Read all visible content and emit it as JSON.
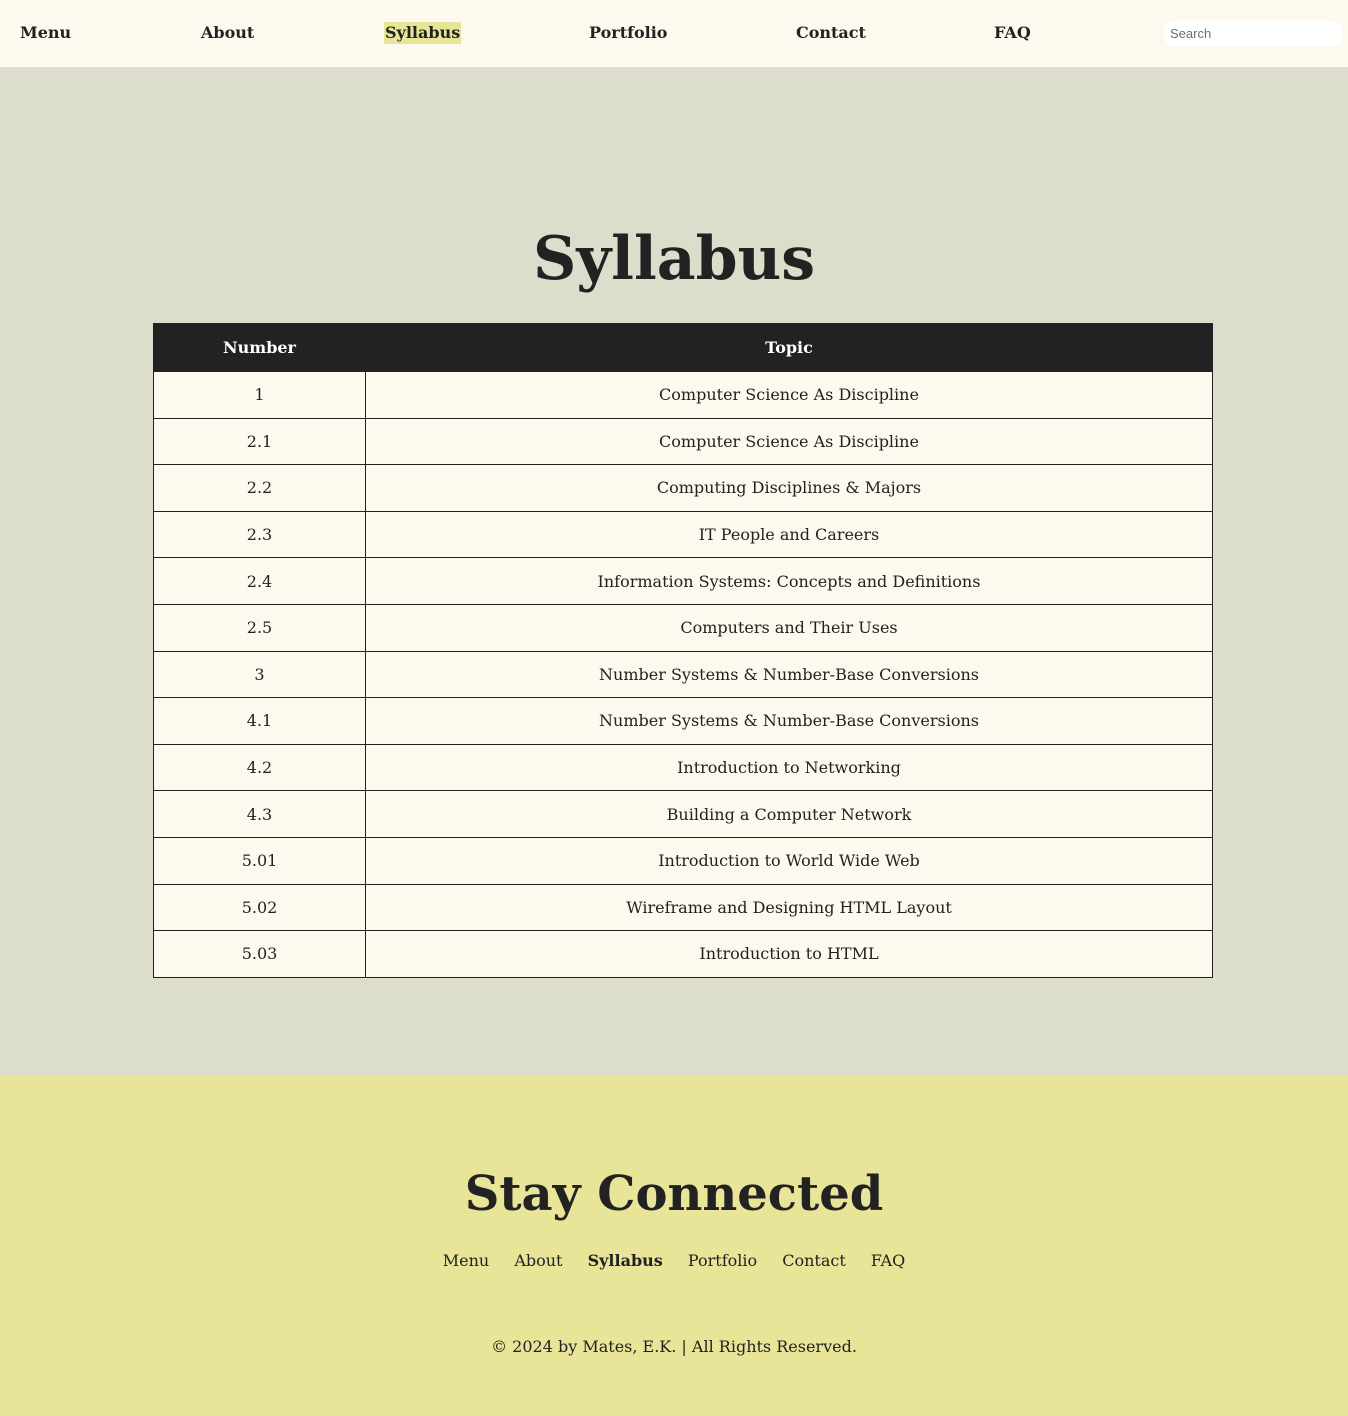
{
  "nav": {
    "items": [
      {
        "label": "Menu",
        "active": false
      },
      {
        "label": "About",
        "active": false
      },
      {
        "label": "Syllabus",
        "active": true
      },
      {
        "label": "Portfolio",
        "active": false
      },
      {
        "label": "Contact",
        "active": false
      },
      {
        "label": "FAQ",
        "active": false
      }
    ],
    "search_placeholder": "Search"
  },
  "main": {
    "title": "Syllabus",
    "table": {
      "headers": [
        "Number",
        "Topic"
      ],
      "rows": [
        [
          "1",
          "Computer Science As Discipline"
        ],
        [
          "2.1",
          "Computer Science As Discipline"
        ],
        [
          "2.2",
          "Computing Disciplines & Majors"
        ],
        [
          "2.3",
          "IT People and Careers"
        ],
        [
          "2.4",
          "Information Systems: Concepts and Definitions"
        ],
        [
          "2.5",
          "Computers and Their Uses"
        ],
        [
          "3",
          "Number Systems & Number-Base Conversions"
        ],
        [
          "4.1",
          "Number Systems & Number-Base Conversions"
        ],
        [
          "4.2",
          "Introduction to Networking"
        ],
        [
          "4.3",
          "Building a Computer Network"
        ],
        [
          "5.01",
          "Introduction to World Wide Web"
        ],
        [
          "5.02",
          "Wireframe and Designing HTML Layout"
        ],
        [
          "5.03",
          "Introduction to HTML"
        ]
      ]
    }
  },
  "footer": {
    "title": "Stay Connected",
    "links": [
      {
        "label": "Menu",
        "active": false
      },
      {
        "label": "About",
        "active": false
      },
      {
        "label": "Syllabus",
        "active": true
      },
      {
        "label": "Portfolio",
        "active": false
      },
      {
        "label": "Contact",
        "active": false
      },
      {
        "label": "FAQ",
        "active": false
      }
    ],
    "copyright": "© 2024 by Mates, E.K. | All Rights Reserved."
  },
  "colors": {
    "nav_bg": "#fdf9ee",
    "main_bg": "#dcddcb",
    "footer_bg": "#e8e498",
    "table_header_bg": "#222222",
    "active_highlight": "#e8e498"
  }
}
